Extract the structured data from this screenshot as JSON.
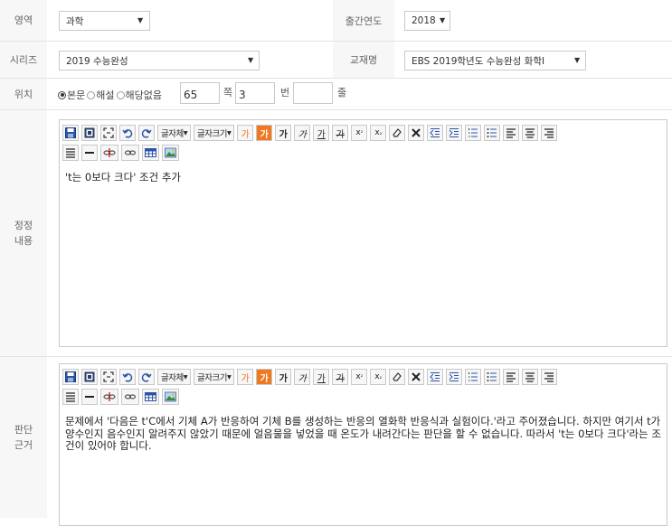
{
  "fields": {
    "area": {
      "label": "영역",
      "value": "과학"
    },
    "pub_year": {
      "label": "출간연도",
      "value": "2018"
    },
    "series": {
      "label": "시리즈",
      "value": "2019 수능완성"
    },
    "textbook": {
      "label": "교재명",
      "value": "EBS 2019학년도 수능완성 화학I"
    },
    "position": {
      "label": "위치",
      "options": [
        "본문",
        "해설",
        "해당없음"
      ],
      "selected": "본문",
      "page": "65",
      "page_unit": "쪽",
      "number": "3",
      "number_unit": "번",
      "line": "",
      "line_unit": "줄"
    }
  },
  "correction": {
    "label_line1": "정정",
    "label_line2": "내용",
    "text": "'t는 0보다 크다' 조건 추가"
  },
  "basis": {
    "label_line1": "판단",
    "label_line2": "근거",
    "text": "문제에서 '다음은 t'C에서 기체 A가 반응하여 기체 B를 생성하는 반응의 열화학 반응식과 실험이다.'라고 주어졌습니다. 하지만 여기서 t가 양수인지 음수인지 알려주지 않았기 때문에 얼음물을 넣었을 때 온도가 내려간다는 판단을 할 수 없습니다. 따라서 't는 0보다 크다'라는 조건이 있어야 합니다."
  },
  "toolbar": {
    "font_label": "글자체",
    "size_label": "글자크기",
    "text_color_glyph": "가",
    "bg_color_glyph": "가",
    "bold_glyph": "가",
    "italic_glyph": "가",
    "underline_glyph": "가",
    "strike_glyph": "가",
    "colors": {
      "text": "#f07020",
      "bg_fill": "#f07820",
      "save": "#2a55a8"
    }
  }
}
